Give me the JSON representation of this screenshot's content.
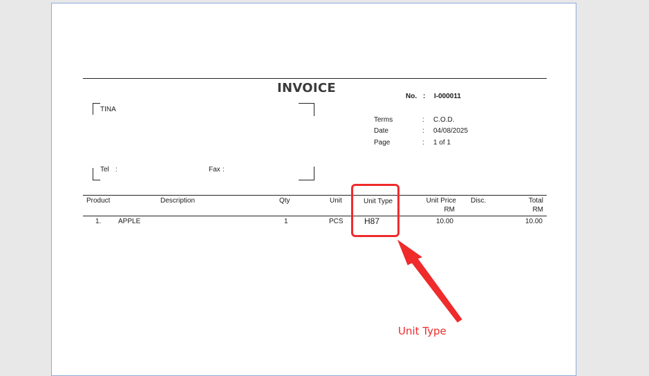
{
  "invoice": {
    "title": "INVOICE",
    "no_label": "No.",
    "no_colon": ":",
    "no_value": "I-000011",
    "customer_name": "TINA",
    "tel_label": "Tel",
    "tel_colon": ":",
    "fax_label": "Fax",
    "fax_colon": ":",
    "meta": [
      {
        "label": "Terms",
        "colon": ":",
        "value": "C.O.D."
      },
      {
        "label": "Date",
        "colon": ":",
        "value": "04/08/2025"
      },
      {
        "label": "Page",
        "colon": ":",
        "value": "1 of 1"
      }
    ]
  },
  "table": {
    "headers": {
      "product": "Product",
      "description": "Description",
      "qty": "Qty",
      "unit": "Unit",
      "unit_type": "Unit Type",
      "unit_price": "Unit Price",
      "unit_price_currency": "RM",
      "disc": "Disc.",
      "total": "Total",
      "total_currency": "RM"
    },
    "rows": [
      {
        "index": "1.",
        "product": "APPLE",
        "description": "",
        "qty": "1",
        "unit": "PCS",
        "unit_type": "H87",
        "unit_price": "10.00",
        "disc": "",
        "total": "10.00"
      }
    ]
  },
  "annotation": {
    "label": "Unit Type",
    "color": "#ef2b2b"
  }
}
